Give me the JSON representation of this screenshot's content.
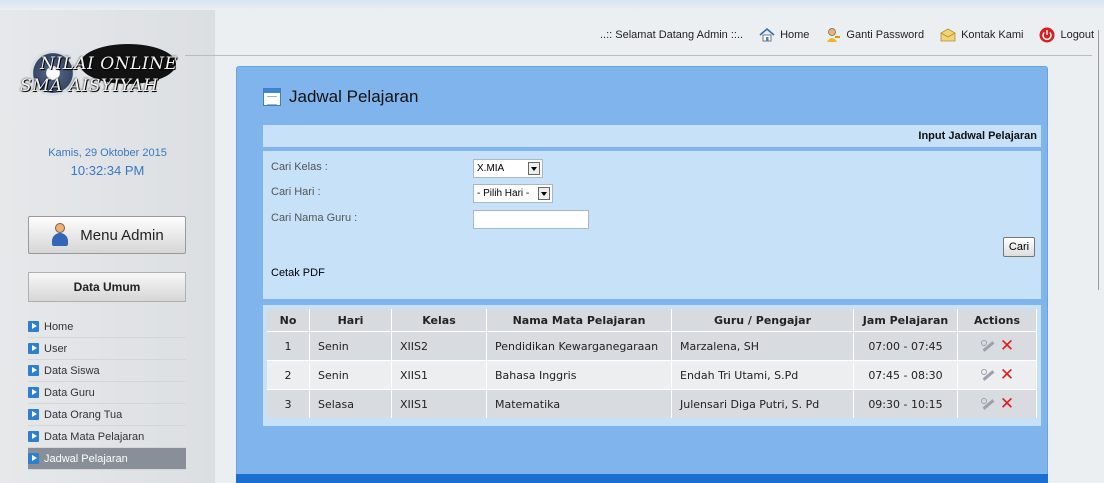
{
  "topnav": {
    "welcome": "..:: Selamat Datang Admin ::..",
    "home": "Home",
    "ganti_password": "Ganti Password",
    "kontak": "Kontak Kami",
    "logout": "Logout"
  },
  "logo": {
    "line1": "NILAI ONLINE",
    "line2": "SMA AISYIYAH"
  },
  "clock": {
    "date": "Kamis, 29 Oktober 2015",
    "time": "10:32:34 PM"
  },
  "sidebar": {
    "menu_admin": "Menu Admin",
    "section": "Data Umum",
    "items": [
      {
        "label": "Home"
      },
      {
        "label": "User"
      },
      {
        "label": "Data Siswa"
      },
      {
        "label": "Data Guru"
      },
      {
        "label": "Data Orang Tua"
      },
      {
        "label": "Data Mata Pelajaran"
      },
      {
        "label": "Jadwal Pelajaran"
      }
    ]
  },
  "main": {
    "title": "Jadwal Pelajaran",
    "input_link": "Input Jadwal Pelajaran",
    "form": {
      "kelas_label": "Cari Kelas :",
      "kelas_value": "X.MIA",
      "hari_label": "Cari Hari :",
      "hari_value": "- Pilih Hari -",
      "guru_label": "Cari Nama Guru :",
      "guru_value": "",
      "cari_button": "Cari",
      "cetak_pdf": "Cetak PDF"
    },
    "table": {
      "headers": [
        "No",
        "Hari",
        "Kelas",
        "Nama Mata Pelajaran",
        "Guru / Pengajar",
        "Jam Pelajaran",
        "Actions"
      ],
      "rows": [
        {
          "no": "1",
          "hari": "Senin",
          "kelas": "XIIS2",
          "mapel": "Pendidikan Kewarganegaraan",
          "guru": "Marzalena, SH",
          "jam": "07:00 - 07:45"
        },
        {
          "no": "2",
          "hari": "Senin",
          "kelas": "XIIS1",
          "mapel": "Bahasa Inggris",
          "guru": "Endah Tri Utami, S.Pd",
          "jam": "07:45 - 08:30"
        },
        {
          "no": "3",
          "hari": "Selasa",
          "kelas": "XIIS1",
          "mapel": "Matematika",
          "guru": "Julensari Diga Putri, S. Pd",
          "jam": "09:30 - 10:15"
        }
      ]
    }
  },
  "icons": {
    "home": "home-icon",
    "password": "key-user-icon",
    "kontak": "envelope-icon",
    "logout": "power-icon",
    "edit": "edit-icon",
    "delete": "delete-icon"
  },
  "colors": {
    "panel": "#7fb5ec",
    "panel_bottom": "#1a6fd0",
    "light_panel": "#c6e1f8",
    "date_text": "#3a78c2",
    "delete": "#e21b1b"
  }
}
